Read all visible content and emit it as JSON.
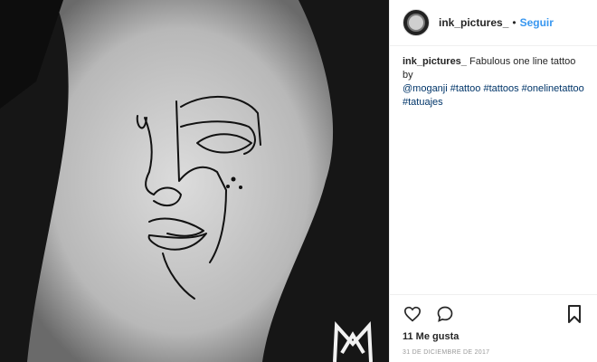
{
  "post": {
    "username": "ink_pictures_",
    "separator": "•",
    "follow_label": "Seguir",
    "caption_user": "ink_pictures_",
    "caption_text": "Fabulous one line tattoo by",
    "caption_mention": "@moganji",
    "hashtags": [
      "#tattoo",
      "#tattoos",
      "#onelinetattoo",
      "#tatuajes"
    ],
    "likes": "11 Me gusta",
    "date": "31 DE DICIEMBRE DE 2017"
  },
  "icons": {
    "like": "heart-icon",
    "comment": "comment-icon",
    "save": "bookmark-icon"
  },
  "colors": {
    "link": "#003569",
    "follow": "#3897f0",
    "text": "#262626"
  }
}
